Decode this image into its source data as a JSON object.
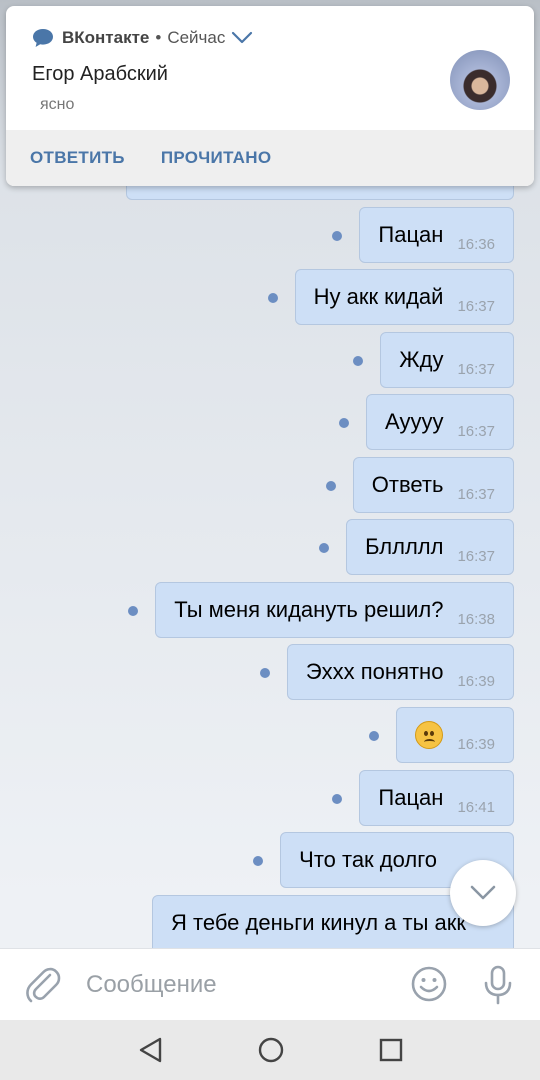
{
  "notification": {
    "app_name": "ВКонтакте",
    "separator": "•",
    "time": "Сейчас",
    "sender": "Егор Арабский",
    "message": "ясно",
    "actions": [
      "ОТВЕТИТЬ",
      "ПРОЧИТАНО"
    ]
  },
  "messages": [
    {
      "text": "",
      "time": "16:36"
    },
    {
      "text": "Пацан",
      "time": "16:36"
    },
    {
      "text": "Ну акк кидай",
      "time": "16:37"
    },
    {
      "text": "Жду",
      "time": "16:37"
    },
    {
      "text": "Ауууу",
      "time": "16:37"
    },
    {
      "text": "Ответь",
      "time": "16:37"
    },
    {
      "text": "Бллллл",
      "time": "16:37"
    },
    {
      "text": "Ты меня кидануть решил?",
      "time": "16:38"
    },
    {
      "text": "Эххх понятно",
      "time": "16:39"
    },
    {
      "text": "",
      "time": "16:39",
      "emoji": "slightly-frowning-face"
    },
    {
      "text": "Пацан",
      "time": "16:41"
    },
    {
      "text": "Что так долго",
      "time": ""
    },
    {
      "text": "Я тебе деньги кинул а ты акк",
      "time": ""
    }
  ],
  "composer": {
    "placeholder": "Сообщение",
    "icons": [
      "attach-icon",
      "emoji-icon",
      "microphone-icon"
    ]
  },
  "navbar": {
    "icons": [
      "back-icon",
      "home-icon",
      "recents-icon"
    ]
  },
  "colors": {
    "accent": "#4a76a8",
    "bubble": "#cddff6",
    "unread_dot": "#6c8ec2"
  }
}
